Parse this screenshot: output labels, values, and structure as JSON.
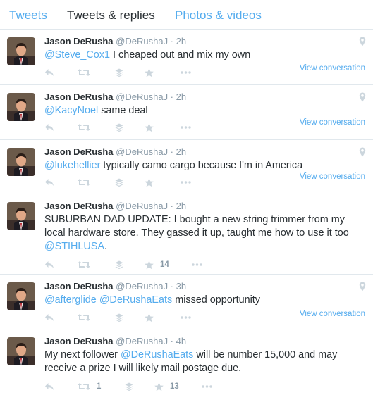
{
  "tabs": [
    {
      "label": "Tweets"
    },
    {
      "label": "Tweets & replies"
    },
    {
      "label": "Photos & videos"
    }
  ],
  "colors": {
    "link": "#55acee",
    "text": "#292f33",
    "muted": "#8899a6",
    "border": "#e1e8ed"
  },
  "tweets": [
    {
      "name": "Jason DeRusha",
      "meta": "@DeRushaJ · 2h",
      "mention": "@Steve_Cox1",
      "body": " I cheaped out and mix my own",
      "view": "View conversation"
    },
    {
      "name": "Jason DeRusha",
      "meta": "@DeRushaJ · 2h",
      "mention": "@KacyNoel",
      "body": " same deal",
      "view": "View conversation"
    },
    {
      "name": "Jason DeRusha",
      "meta": "@DeRushaJ · 2h",
      "mention": "@lukehellier",
      "body": " typically camo cargo because I'm in America",
      "view": "View conversation"
    },
    {
      "name": "Jason DeRusha",
      "meta": "@DeRushaJ · 2h",
      "body": "SUBURBAN DAD UPDATE: I bought a new string trimmer from my local hardware store. They gassed it up, taught me how to use it too ",
      "mention": "@STIHLUSA",
      "tail": ".",
      "favorites": "14"
    },
    {
      "name": "Jason DeRusha",
      "meta": "@DeRushaJ · 3h",
      "mention": "@afterglide",
      "mention2": "@DeRushaEats",
      "body": " missed opportunity",
      "view": "View conversation"
    },
    {
      "name": "Jason DeRusha",
      "meta": "@DeRushaJ · 4h",
      "body": "My next follower ",
      "mention": "@DeRushaEats",
      "tail": " will be number 15,000 and may receive a prize I will likely mail postage due.",
      "retweets": "1",
      "favorites": "13"
    }
  ],
  "icons": [
    "reply-icon",
    "retweet-icon",
    "stack-icon",
    "star-icon",
    "more-icon",
    "location-pin-icon"
  ]
}
